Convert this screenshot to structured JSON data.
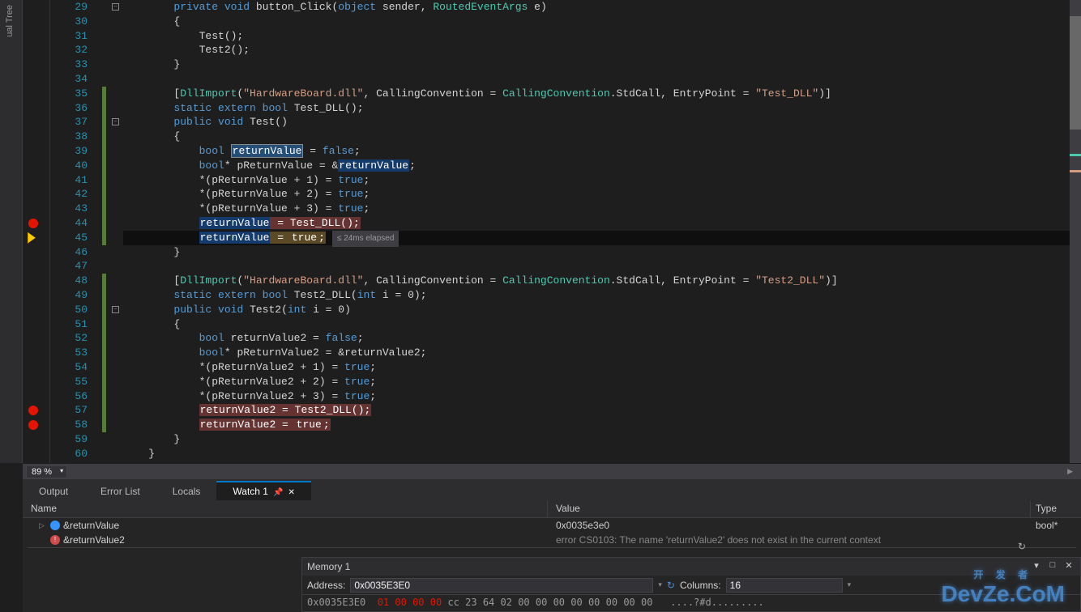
{
  "sidePanel": {
    "label": "ual Tree"
  },
  "lineStart": 29,
  "lineEnd": 60,
  "breakpoints": [
    44,
    57,
    58
  ],
  "currentLine": 45,
  "currentLinePerf": "≤ 24ms elapsed",
  "foldMarkers": [
    {
      "line": 29,
      "symbol": "−"
    },
    {
      "line": 37,
      "symbol": "−"
    },
    {
      "line": 50,
      "symbol": "−"
    }
  ],
  "modifiedRanges": [
    {
      "from": 35,
      "to": 45
    },
    {
      "from": 48,
      "to": 58
    }
  ],
  "code": [
    {
      "n": 29,
      "segs": [
        {
          "t": "        ",
          "c": ""
        },
        {
          "t": "private",
          "c": "kw"
        },
        {
          "t": " ",
          "c": ""
        },
        {
          "t": "void",
          "c": "kw"
        },
        {
          "t": " button_Click(",
          "c": ""
        },
        {
          "t": "object",
          "c": "kw"
        },
        {
          "t": " sender, ",
          "c": ""
        },
        {
          "t": "RoutedEventArgs",
          "c": "type"
        },
        {
          "t": " e)",
          "c": ""
        }
      ]
    },
    {
      "n": 30,
      "segs": [
        {
          "t": "        {",
          "c": ""
        }
      ]
    },
    {
      "n": 31,
      "segs": [
        {
          "t": "            Test();",
          "c": ""
        }
      ]
    },
    {
      "n": 32,
      "segs": [
        {
          "t": "            Test2();",
          "c": ""
        }
      ]
    },
    {
      "n": 33,
      "segs": [
        {
          "t": "        }",
          "c": ""
        }
      ]
    },
    {
      "n": 34,
      "segs": [
        {
          "t": "",
          "c": ""
        }
      ]
    },
    {
      "n": 35,
      "segs": [
        {
          "t": "        [",
          "c": ""
        },
        {
          "t": "DllImport",
          "c": "type"
        },
        {
          "t": "(",
          "c": ""
        },
        {
          "t": "\"HardwareBoard.dll\"",
          "c": "str"
        },
        {
          "t": ", CallingConvention = ",
          "c": ""
        },
        {
          "t": "CallingConvention",
          "c": "type"
        },
        {
          "t": ".StdCall, EntryPoint = ",
          "c": ""
        },
        {
          "t": "\"Test_DLL\"",
          "c": "str"
        },
        {
          "t": ")]",
          "c": ""
        }
      ]
    },
    {
      "n": 36,
      "segs": [
        {
          "t": "        ",
          "c": ""
        },
        {
          "t": "static",
          "c": "kw"
        },
        {
          "t": " ",
          "c": ""
        },
        {
          "t": "extern",
          "c": "kw"
        },
        {
          "t": " ",
          "c": ""
        },
        {
          "t": "bool",
          "c": "kw"
        },
        {
          "t": " Test_DLL();",
          "c": ""
        }
      ]
    },
    {
      "n": 37,
      "segs": [
        {
          "t": "        ",
          "c": ""
        },
        {
          "t": "public",
          "c": "kw"
        },
        {
          "t": " ",
          "c": ""
        },
        {
          "t": "void",
          "c": "kw"
        },
        {
          "t": " Test()",
          "c": ""
        }
      ]
    },
    {
      "n": 38,
      "segs": [
        {
          "t": "        {",
          "c": ""
        }
      ]
    },
    {
      "n": 39,
      "segs": [
        {
          "t": "            ",
          "c": ""
        },
        {
          "t": "bool",
          "c": "kw"
        },
        {
          "t": " ",
          "c": ""
        },
        {
          "t": "returnValue",
          "c": "hl-green"
        },
        {
          "t": " = ",
          "c": ""
        },
        {
          "t": "false",
          "c": "kw"
        },
        {
          "t": ";",
          "c": ""
        }
      ]
    },
    {
      "n": 40,
      "segs": [
        {
          "t": "            ",
          "c": ""
        },
        {
          "t": "bool",
          "c": "kw"
        },
        {
          "t": "* pReturnValue = &",
          "c": ""
        },
        {
          "t": "returnValue",
          "c": "hl-returnvalue-sel"
        },
        {
          "t": ";",
          "c": ""
        }
      ]
    },
    {
      "n": 41,
      "segs": [
        {
          "t": "            *(pReturnValue + 1) = ",
          "c": ""
        },
        {
          "t": "true",
          "c": "kw"
        },
        {
          "t": ";",
          "c": ""
        }
      ]
    },
    {
      "n": 42,
      "segs": [
        {
          "t": "            *(pReturnValue + 2) = ",
          "c": ""
        },
        {
          "t": "true",
          "c": "kw"
        },
        {
          "t": ";",
          "c": ""
        }
      ]
    },
    {
      "n": 43,
      "segs": [
        {
          "t": "            *(pReturnValue + 3) = ",
          "c": ""
        },
        {
          "t": "true",
          "c": "kw"
        },
        {
          "t": ";",
          "c": ""
        }
      ]
    },
    {
      "n": 44,
      "segs": [
        {
          "t": "            ",
          "c": ""
        },
        {
          "t": "returnValue",
          "c": "hl-returnvalue-sel"
        },
        {
          "t": " = Test_DLL();",
          "c": "hl-red"
        }
      ]
    },
    {
      "n": 45,
      "segs": [
        {
          "t": "            ",
          "c": ""
        },
        {
          "t": "returnValue",
          "c": "hl-returnvalue-sel"
        },
        {
          "t": " = ",
          "c": "hl-returnvalue"
        },
        {
          "t": "true",
          "c": "hl-returnvalue"
        },
        {
          "t": ";",
          "c": "hl-returnvalue"
        }
      ]
    },
    {
      "n": 46,
      "segs": [
        {
          "t": "        }",
          "c": ""
        }
      ]
    },
    {
      "n": 47,
      "segs": [
        {
          "t": "",
          "c": ""
        }
      ]
    },
    {
      "n": 48,
      "segs": [
        {
          "t": "        [",
          "c": ""
        },
        {
          "t": "DllImport",
          "c": "type"
        },
        {
          "t": "(",
          "c": ""
        },
        {
          "t": "\"HardwareBoard.dll\"",
          "c": "str"
        },
        {
          "t": ", CallingConvention = ",
          "c": ""
        },
        {
          "t": "CallingConvention",
          "c": "type"
        },
        {
          "t": ".StdCall, EntryPoint = ",
          "c": ""
        },
        {
          "t": "\"Test2_DLL\"",
          "c": "str"
        },
        {
          "t": ")]",
          "c": ""
        }
      ]
    },
    {
      "n": 49,
      "segs": [
        {
          "t": "        ",
          "c": ""
        },
        {
          "t": "static",
          "c": "kw"
        },
        {
          "t": " ",
          "c": ""
        },
        {
          "t": "extern",
          "c": "kw"
        },
        {
          "t": " ",
          "c": ""
        },
        {
          "t": "bool",
          "c": "kw"
        },
        {
          "t": " Test2_DLL(",
          "c": ""
        },
        {
          "t": "int",
          "c": "kw"
        },
        {
          "t": " i = 0);",
          "c": ""
        }
      ]
    },
    {
      "n": 50,
      "segs": [
        {
          "t": "        ",
          "c": ""
        },
        {
          "t": "public",
          "c": "kw"
        },
        {
          "t": " ",
          "c": ""
        },
        {
          "t": "void",
          "c": "kw"
        },
        {
          "t": " Test2(",
          "c": ""
        },
        {
          "t": "int",
          "c": "kw"
        },
        {
          "t": " i = 0)",
          "c": ""
        }
      ]
    },
    {
      "n": 51,
      "segs": [
        {
          "t": "        {",
          "c": ""
        }
      ]
    },
    {
      "n": 52,
      "segs": [
        {
          "t": "            ",
          "c": ""
        },
        {
          "t": "bool",
          "c": "kw"
        },
        {
          "t": " returnValue2 = ",
          "c": ""
        },
        {
          "t": "false",
          "c": "kw"
        },
        {
          "t": ";",
          "c": ""
        }
      ]
    },
    {
      "n": 53,
      "segs": [
        {
          "t": "            ",
          "c": ""
        },
        {
          "t": "bool",
          "c": "kw"
        },
        {
          "t": "* pReturnValue2 = &returnValue2;",
          "c": ""
        }
      ]
    },
    {
      "n": 54,
      "segs": [
        {
          "t": "            *(pReturnValue2 + 1) = ",
          "c": ""
        },
        {
          "t": "true",
          "c": "kw"
        },
        {
          "t": ";",
          "c": ""
        }
      ]
    },
    {
      "n": 55,
      "segs": [
        {
          "t": "            *(pReturnValue2 + 2) = ",
          "c": ""
        },
        {
          "t": "true",
          "c": "kw"
        },
        {
          "t": ";",
          "c": ""
        }
      ]
    },
    {
      "n": 56,
      "segs": [
        {
          "t": "            *(pReturnValue2 + 3) = ",
          "c": ""
        },
        {
          "t": "true",
          "c": "kw"
        },
        {
          "t": ";",
          "c": ""
        }
      ]
    },
    {
      "n": 57,
      "segs": [
        {
          "t": "            ",
          "c": ""
        },
        {
          "t": "returnValue2 = Test2_DLL();",
          "c": "hl-red"
        }
      ]
    },
    {
      "n": 58,
      "segs": [
        {
          "t": "            ",
          "c": ""
        },
        {
          "t": "returnValue2 = ",
          "c": "hl-red"
        },
        {
          "t": "true",
          "c": "hl-red"
        },
        {
          "t": ";",
          "c": "hl-red"
        }
      ]
    },
    {
      "n": 59,
      "segs": [
        {
          "t": "        }",
          "c": ""
        }
      ]
    },
    {
      "n": 60,
      "segs": [
        {
          "t": "    }",
          "c": ""
        }
      ]
    }
  ],
  "zoom": "89 %",
  "bottomTabs": [
    {
      "label": "Output",
      "active": false
    },
    {
      "label": "Error List",
      "active": false
    },
    {
      "label": "Locals",
      "active": false
    },
    {
      "label": "Watch 1",
      "active": true
    }
  ],
  "watch": {
    "headers": {
      "name": "Name",
      "value": "Value",
      "type": "Type"
    },
    "rows": [
      {
        "icon": "var",
        "name": "&returnValue",
        "value": "0x0035e3e0",
        "type": "bool*",
        "expandable": true
      },
      {
        "icon": "err",
        "name": "&returnValue2",
        "value": "error CS0103: The name 'returnValue2' does not exist in the current context",
        "type": "",
        "expandable": false
      }
    ]
  },
  "memory": {
    "title": "Memory 1",
    "addressLabel": "Address:",
    "addressValue": "0x0035E3E0",
    "columnsLabel": "Columns:",
    "columnsValue": "16",
    "row": {
      "addr": "0x0035E3E0",
      "bytesRed": [
        "01",
        "00",
        "00",
        "00"
      ],
      "bytesGray": [
        "cc",
        "23",
        "64",
        "02",
        "00",
        "00",
        "00",
        "00",
        "00",
        "00",
        "00",
        "00"
      ],
      "ascii": "....?#d........."
    }
  },
  "watermark": {
    "main": "DevZe.CoM",
    "sub": "开 发 者"
  }
}
